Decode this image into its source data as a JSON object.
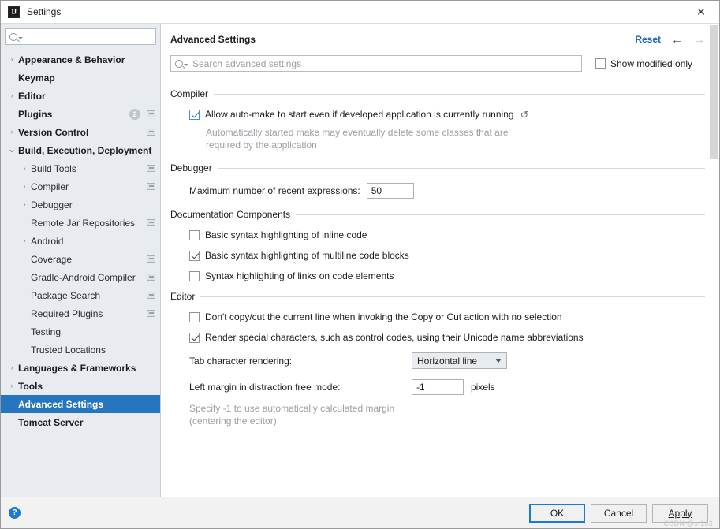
{
  "window": {
    "title": "Settings",
    "logo_text": "IJ",
    "close_label": "✕"
  },
  "sidebar": {
    "search": {
      "value": "",
      "placeholder": ""
    },
    "items": [
      {
        "label": "Appearance & Behavior",
        "level": 0,
        "arrow": "›",
        "bold": true
      },
      {
        "label": "Keymap",
        "level": 0,
        "arrow": "",
        "bold": true
      },
      {
        "label": "Editor",
        "level": 0,
        "arrow": "›",
        "bold": true
      },
      {
        "label": "Plugins",
        "level": 0,
        "arrow": "",
        "bold": true,
        "badge": "2",
        "proj": true
      },
      {
        "label": "Version Control",
        "level": 0,
        "arrow": "›",
        "bold": true,
        "proj": true
      },
      {
        "label": "Build, Execution, Deployment",
        "level": 0,
        "arrow": "⌄",
        "bold": true,
        "expanded": true
      },
      {
        "label": "Build Tools",
        "level": 1,
        "arrow": "›",
        "proj": true
      },
      {
        "label": "Compiler",
        "level": 1,
        "arrow": "›",
        "proj": true
      },
      {
        "label": "Debugger",
        "level": 1,
        "arrow": "›"
      },
      {
        "label": "Remote Jar Repositories",
        "level": 1,
        "arrow": "",
        "proj": true
      },
      {
        "label": "Android",
        "level": 1,
        "arrow": "›"
      },
      {
        "label": "Coverage",
        "level": 1,
        "arrow": "",
        "proj": true
      },
      {
        "label": "Gradle-Android Compiler",
        "level": 1,
        "arrow": "",
        "proj": true
      },
      {
        "label": "Package Search",
        "level": 1,
        "arrow": "",
        "proj": true
      },
      {
        "label": "Required Plugins",
        "level": 1,
        "arrow": "",
        "proj": true
      },
      {
        "label": "Testing",
        "level": 1,
        "arrow": ""
      },
      {
        "label": "Trusted Locations",
        "level": 1,
        "arrow": ""
      },
      {
        "label": "Languages & Frameworks",
        "level": 0,
        "arrow": "›",
        "bold": true
      },
      {
        "label": "Tools",
        "level": 0,
        "arrow": "›",
        "bold": true
      },
      {
        "label": "Advanced Settings",
        "level": 0,
        "arrow": "",
        "bold": true,
        "selected": true
      },
      {
        "label": "Tomcat Server",
        "level": 0,
        "arrow": "",
        "bold": true
      }
    ]
  },
  "main": {
    "title": "Advanced Settings",
    "reset_label": "Reset",
    "back_arrow": "←",
    "forward_arrow": "→",
    "search": {
      "value": "",
      "placeholder": "Search advanced settings"
    },
    "show_modified": {
      "label": "Show modified only",
      "checked": false
    },
    "sections": [
      {
        "title": "Compiler",
        "rows": [
          {
            "kind": "checkbox",
            "label": "Allow auto-make to start even if developed application is currently running",
            "checked": true,
            "revert": "↺",
            "hint": "Automatically started make may eventually delete some classes that are required by the application"
          }
        ]
      },
      {
        "title": "Debugger",
        "rows": [
          {
            "kind": "field",
            "label": "Maximum number of recent expressions:",
            "value": "50",
            "unit": ""
          }
        ]
      },
      {
        "title": "Documentation Components",
        "rows": [
          {
            "kind": "checkbox",
            "label": "Basic syntax highlighting of inline code",
            "checked": false
          },
          {
            "kind": "checkbox",
            "label": "Basic syntax highlighting of multiline code blocks",
            "checked": true
          },
          {
            "kind": "checkbox",
            "label": "Syntax highlighting of links on code elements",
            "checked": false
          }
        ]
      },
      {
        "title": "Editor",
        "rows": [
          {
            "kind": "checkbox",
            "label": "Don't copy/cut the current line when invoking the Copy or Cut action with no selection",
            "checked": false
          },
          {
            "kind": "checkbox",
            "label": "Render special characters, such as control codes, using their Unicode name abbreviations",
            "checked": true
          },
          {
            "kind": "combo",
            "label": "Tab character rendering:",
            "value": "Horizontal line"
          },
          {
            "kind": "field-wide",
            "label": "Left margin in distraction free mode:",
            "value": "-1",
            "unit": "pixels",
            "hint": "Specify -1 to use automatically calculated margin (centering the editor)"
          }
        ]
      }
    ]
  },
  "footer": {
    "help_label": "?",
    "ok_label": "OK",
    "cancel_label": "Cancel",
    "apply_label": "Apply"
  },
  "watermark": "CSDN @s:103"
}
